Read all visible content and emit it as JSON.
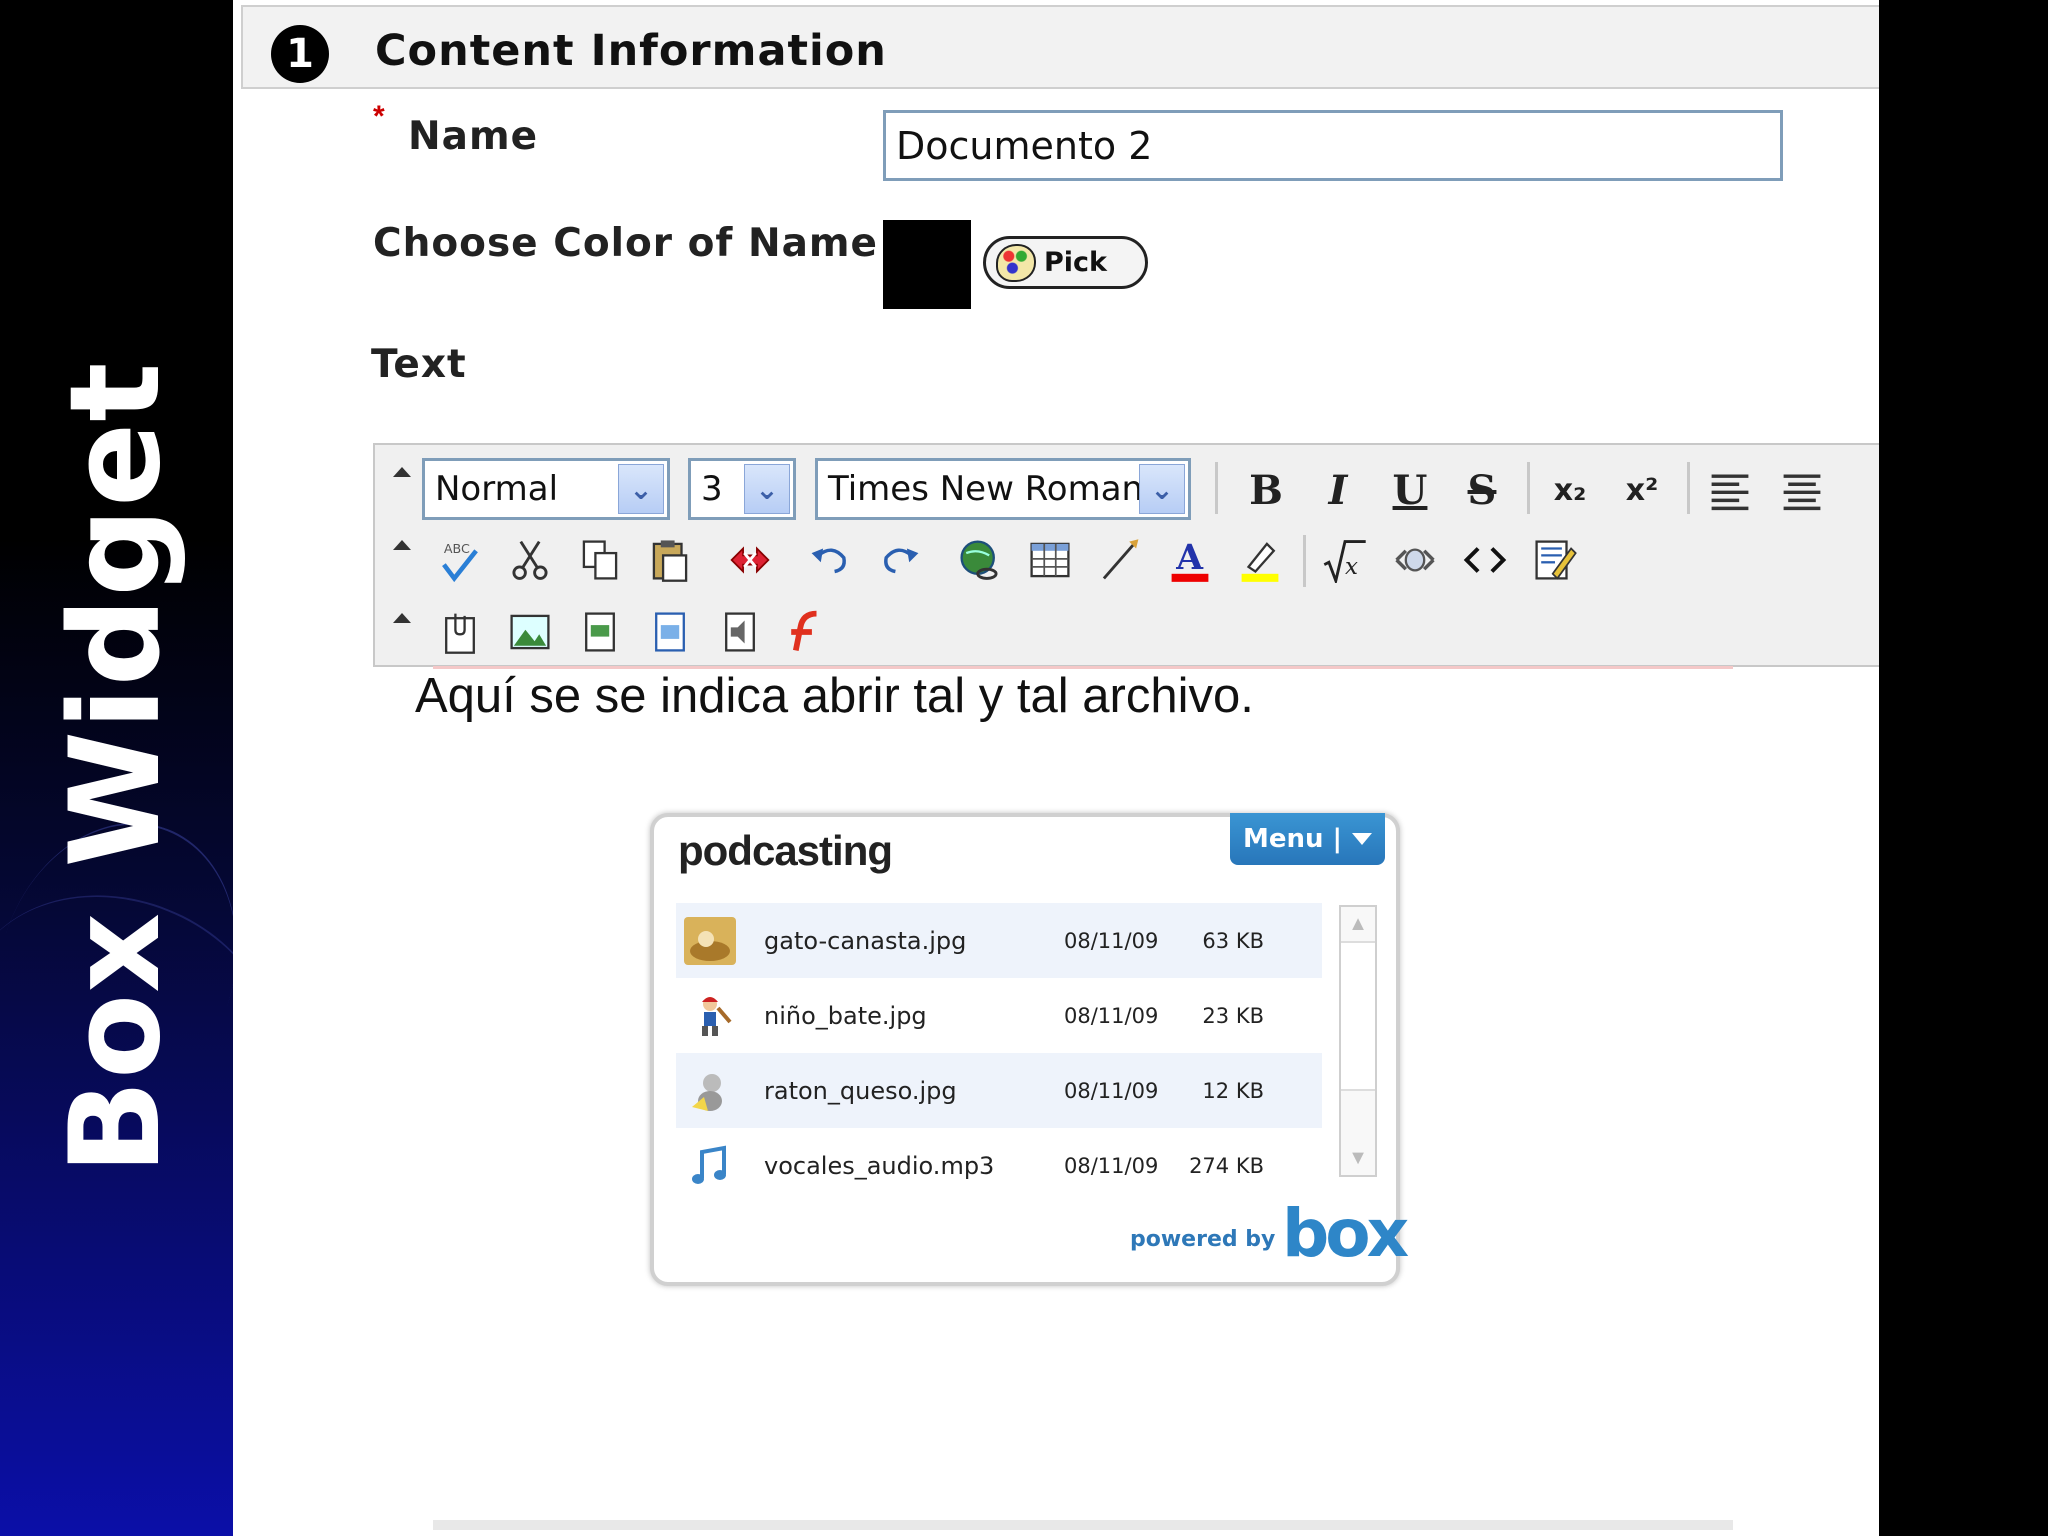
{
  "slide": {
    "title": "Box Widget"
  },
  "section": {
    "step": "1",
    "title": "Content Information"
  },
  "form": {
    "required_marker": "*",
    "name_label": "Name",
    "name_value": "Documento 2",
    "color_label": "Choose Color of Name",
    "color_value": "#000000",
    "pick_label": "Pick",
    "text_label": "Text"
  },
  "toolbar": {
    "format_select": "Normal",
    "size_select": "3",
    "font_select": "Times New Roman",
    "bold": "B",
    "italic": "I",
    "underline": "U",
    "strikethrough": "S",
    "subscript": "x₂",
    "superscript": "x²"
  },
  "editor": {
    "content": "Aquí se se indica abrir tal y tal archivo."
  },
  "box_widget": {
    "folder": "podcasting",
    "menu_label": "Menu |",
    "files": [
      {
        "name": "gato-canasta.jpg",
        "date": "08/11/09",
        "size": "63 KB",
        "icon": "image-thumbnail-icon"
      },
      {
        "name": "niño_bate.jpg",
        "date": "08/11/09",
        "size": "23 KB",
        "icon": "image-thumbnail-icon"
      },
      {
        "name": "raton_queso.jpg",
        "date": "08/11/09",
        "size": "12 KB",
        "icon": "image-thumbnail-icon"
      },
      {
        "name": "vocales_audio.mp3",
        "date": "08/11/09",
        "size": "274 KB",
        "icon": "music-note-icon"
      }
    ],
    "powered_by": "powered by",
    "brand": "box"
  },
  "colors": {
    "sidebar_bottom": "#0b0fa8",
    "menu_button": "#2876ba",
    "box_brand": "#2e86c8",
    "required": "#cc0000"
  }
}
